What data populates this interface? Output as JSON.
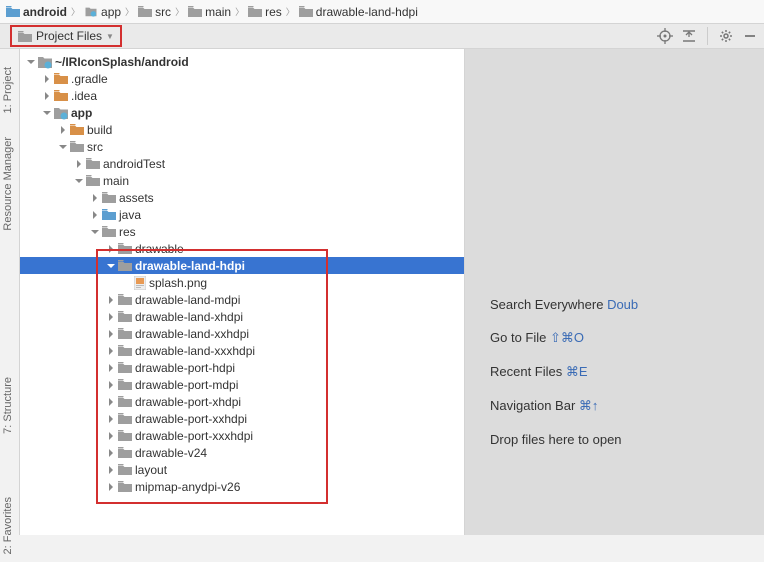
{
  "breadcrumb": [
    {
      "label": "android",
      "bold": true,
      "folder": "blue"
    },
    {
      "label": "app",
      "folder": "module"
    },
    {
      "label": "src",
      "folder": "gray"
    },
    {
      "label": "main",
      "folder": "gray"
    },
    {
      "label": "res",
      "folder": "gray"
    },
    {
      "label": "drawable-land-hdpi",
      "folder": "gray"
    }
  ],
  "project_dropdown": "Project Files",
  "sidebar_tabs": {
    "t1": "1: Project",
    "t2": "Resource Manager",
    "t3": "7: Structure",
    "t4": "2: Favorites"
  },
  "tree": {
    "root": "~/IRIconSplash/android",
    "gradle": ".gradle",
    "idea": ".idea",
    "app": "app",
    "build": "build",
    "src": "src",
    "androidTest": "androidTest",
    "main": "main",
    "assets": "assets",
    "java": "java",
    "res": "res",
    "drawable": "drawable",
    "drawable_land_hdpi": "drawable-land-hdpi",
    "splash": "splash.png",
    "drawable_land_mdpi": "drawable-land-mdpi",
    "drawable_land_xhdpi": "drawable-land-xhdpi",
    "drawable_land_xxhdpi": "drawable-land-xxhdpi",
    "drawable_land_xxxhdpi": "drawable-land-xxxhdpi",
    "drawable_port_hdpi": "drawable-port-hdpi",
    "drawable_port_mdpi": "drawable-port-mdpi",
    "drawable_port_xhdpi": "drawable-port-xhdpi",
    "drawable_port_xxhdpi": "drawable-port-xxhdpi",
    "drawable_port_xxxhdpi": "drawable-port-xxxhdpi",
    "drawable_v24": "drawable-v24",
    "layout": "layout",
    "mipmap": "mipmap-anydpi-v26"
  },
  "tips": {
    "search": "Search Everywhere ",
    "search_key": "Doub",
    "goto": "Go to File ",
    "goto_key": "⇧⌘O",
    "recent": "Recent Files ",
    "recent_key": "⌘E",
    "nav": "Navigation Bar ",
    "nav_key": "⌘↑",
    "drop": "Drop files here to open"
  }
}
